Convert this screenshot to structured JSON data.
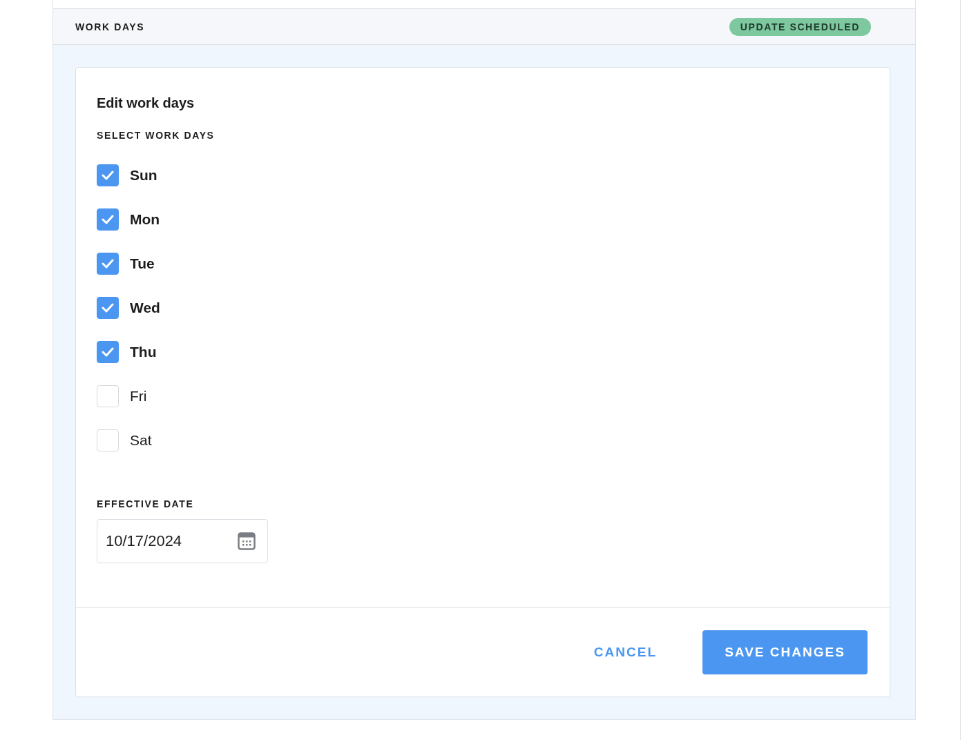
{
  "section": {
    "title": "WORK DAYS",
    "badge": "UPDATE SCHEDULED"
  },
  "form": {
    "title": "Edit work days",
    "days_label": "SELECT WORK DAYS",
    "days": [
      {
        "label": "Sun",
        "checked": true
      },
      {
        "label": "Mon",
        "checked": true
      },
      {
        "label": "Tue",
        "checked": true
      },
      {
        "label": "Wed",
        "checked": true
      },
      {
        "label": "Thu",
        "checked": true
      },
      {
        "label": "Fri",
        "checked": false
      },
      {
        "label": "Sat",
        "checked": false
      }
    ],
    "date_label": "EFFECTIVE DATE",
    "date_value": "10/17/2024"
  },
  "buttons": {
    "cancel": "CANCEL",
    "save": "SAVE CHANGES"
  }
}
